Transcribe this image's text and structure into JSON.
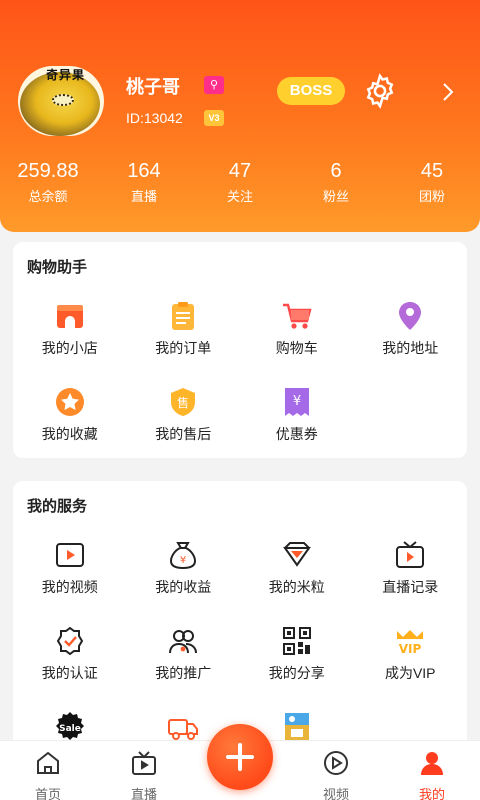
{
  "profile": {
    "brand_text": "奇异果",
    "username": "桃子哥",
    "id_text": "ID:13042",
    "level": "V3",
    "boss_label": "BOSS"
  },
  "stats": [
    {
      "value": "259.88",
      "label": "总余额"
    },
    {
      "value": "164",
      "label": "直播"
    },
    {
      "value": "47",
      "label": "关注"
    },
    {
      "value": "6",
      "label": "粉丝"
    },
    {
      "value": "45",
      "label": "团粉"
    }
  ],
  "shopping": {
    "title": "购物助手",
    "items": [
      {
        "label": "我的小店",
        "icon": "shop-icon"
      },
      {
        "label": "我的订单",
        "icon": "order-icon"
      },
      {
        "label": "购物车",
        "icon": "cart-icon"
      },
      {
        "label": "我的地址",
        "icon": "location-icon"
      },
      {
        "label": "我的收藏",
        "icon": "star-icon"
      },
      {
        "label": "我的售后",
        "icon": "after-sale-icon"
      },
      {
        "label": "优惠券",
        "icon": "coupon-icon"
      }
    ]
  },
  "services": {
    "title": "我的服务",
    "items": [
      {
        "label": "我的视频",
        "icon": "video-icon"
      },
      {
        "label": "我的收益",
        "icon": "money-bag-icon"
      },
      {
        "label": "我的米粒",
        "icon": "gem-icon"
      },
      {
        "label": "直播记录",
        "icon": "tv-icon"
      },
      {
        "label": "我的认证",
        "icon": "verified-icon"
      },
      {
        "label": "我的推广",
        "icon": "users-icon"
      },
      {
        "label": "我的分享",
        "icon": "qr-icon"
      },
      {
        "label": "成为VIP",
        "icon": "vip-crown-icon"
      },
      {
        "label": "",
        "icon": "sale-icon"
      },
      {
        "label": "",
        "icon": "truck-icon"
      },
      {
        "label": "",
        "icon": "image-box-icon"
      }
    ],
    "sale_badge_text": "Sale"
  },
  "tabs": [
    {
      "label": "首页",
      "icon": "home-icon"
    },
    {
      "label": "直播",
      "icon": "live-tv-icon"
    },
    {
      "label": "",
      "icon": "plus-icon"
    },
    {
      "label": "视频",
      "icon": "play-icon"
    },
    {
      "label": "我的",
      "icon": "profile-icon"
    }
  ],
  "colors": {
    "accent": "#ff4a1a",
    "boss": "#ffcf2e",
    "vip_pink": "#ff2e8a",
    "active_tab": "#ff3c1e"
  }
}
